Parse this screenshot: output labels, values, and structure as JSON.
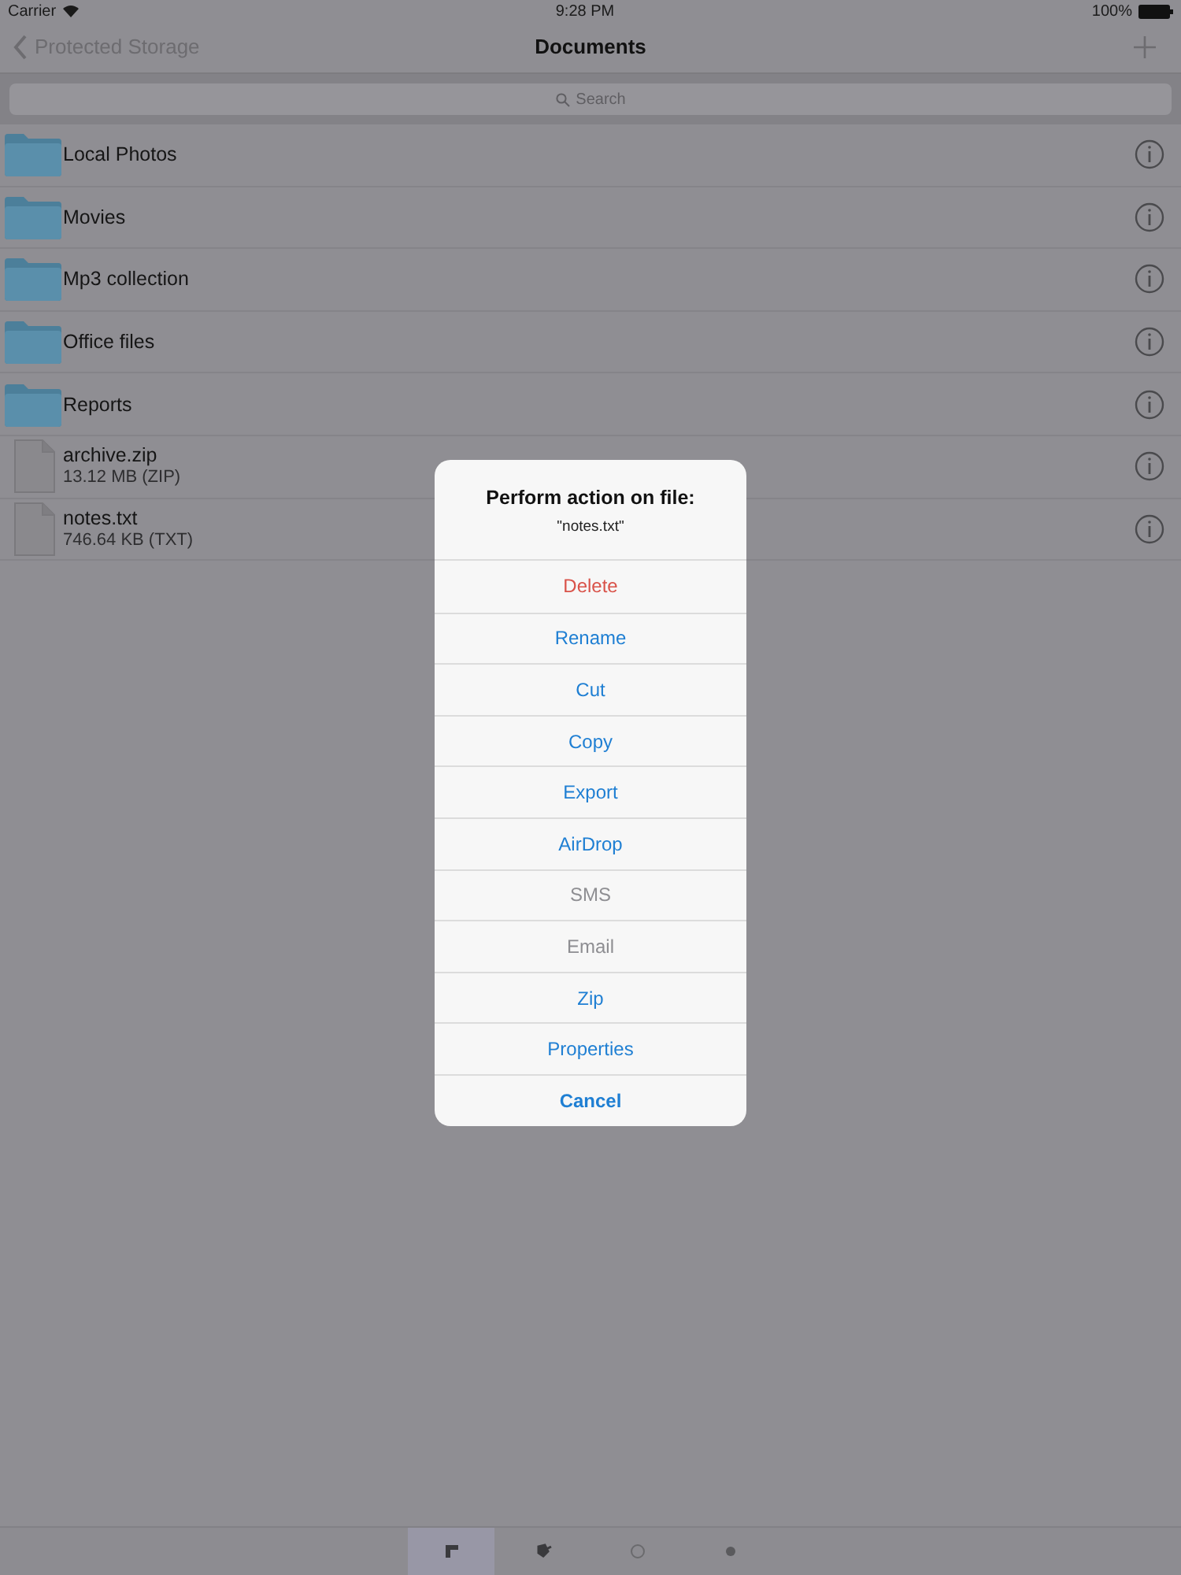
{
  "status_bar": {
    "carrier": "Carrier",
    "time": "9:28 PM",
    "battery": "100%"
  },
  "nav": {
    "back": "Protected Storage",
    "title": "Documents"
  },
  "search": {
    "placeholder": "Search"
  },
  "items": [
    {
      "kind": "folder",
      "name": "Local Photos"
    },
    {
      "kind": "folder",
      "name": "Movies"
    },
    {
      "kind": "folder",
      "name": "Mp3 collection"
    },
    {
      "kind": "folder",
      "name": "Office files"
    },
    {
      "kind": "folder",
      "name": "Reports"
    },
    {
      "kind": "file",
      "name": "archive.zip",
      "detail": "13.12  MB (ZIP)"
    },
    {
      "kind": "file",
      "name": "notes.txt",
      "detail": "746.64  KB (TXT)"
    }
  ],
  "dialog": {
    "title": "Perform action on file:",
    "subtitle": "\"notes.txt\"",
    "actions": [
      {
        "label": "Delete",
        "kind": "destructive"
      },
      {
        "label": "Rename",
        "kind": "normal"
      },
      {
        "label": "Cut",
        "kind": "normal"
      },
      {
        "label": "Copy",
        "kind": "normal"
      },
      {
        "label": "Export",
        "kind": "normal"
      },
      {
        "label": "AirDrop",
        "kind": "normal"
      },
      {
        "label": "SMS",
        "kind": "disabled"
      },
      {
        "label": "Email",
        "kind": "disabled"
      },
      {
        "label": "Zip",
        "kind": "normal"
      },
      {
        "label": "Properties",
        "kind": "normal"
      },
      {
        "label": "Cancel",
        "kind": "cancel"
      }
    ]
  },
  "tab_bar": [
    {
      "selected": true
    },
    {
      "selected": false
    },
    {
      "selected": false
    },
    {
      "selected": false
    }
  ]
}
